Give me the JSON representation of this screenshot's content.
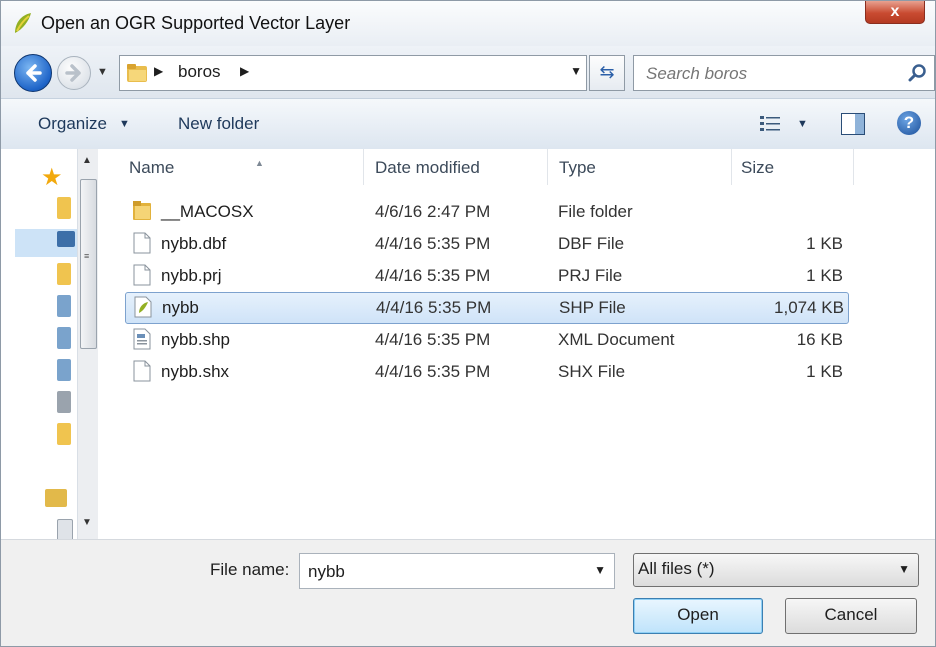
{
  "window": {
    "title": "Open an OGR Supported Vector Layer",
    "close_label": "x"
  },
  "address": {
    "folder": "boros"
  },
  "search": {
    "placeholder": "Search boros"
  },
  "toolbar": {
    "organize": "Organize",
    "new_folder": "New folder"
  },
  "columns": {
    "name": "Name",
    "date": "Date modified",
    "type": "Type",
    "size": "Size"
  },
  "files": [
    {
      "name": "__MACOSX",
      "date": "4/6/16 2:47 PM",
      "type": "File folder",
      "size": "",
      "icon": "folder-icon"
    },
    {
      "name": "nybb.dbf",
      "date": "4/4/16 5:35 PM",
      "type": "DBF File",
      "size": "1 KB",
      "icon": "file-icon"
    },
    {
      "name": "nybb.prj",
      "date": "4/4/16 5:35 PM",
      "type": "PRJ File",
      "size": "1 KB",
      "icon": "file-icon"
    },
    {
      "name": "nybb",
      "date": "4/4/16 5:35 PM",
      "type": "SHP File",
      "size": "1,074 KB",
      "icon": "shapefile-icon",
      "selected": true
    },
    {
      "name": "nybb.shp",
      "date": "4/4/16 5:35 PM",
      "type": "XML Document",
      "size": "16 KB",
      "icon": "xml-file-icon"
    },
    {
      "name": "nybb.shx",
      "date": "4/4/16 5:35 PM",
      "type": "SHX File",
      "size": "1 KB",
      "icon": "file-icon"
    }
  ],
  "bottom": {
    "file_name_label": "File name:",
    "file_name_value": "nybb",
    "filter": "All files (*)",
    "open_label": "Open",
    "cancel_label": "Cancel"
  },
  "colors": {
    "accent": "#1e64c8",
    "selection": "#cfe3f8",
    "close": "#c94b31"
  }
}
